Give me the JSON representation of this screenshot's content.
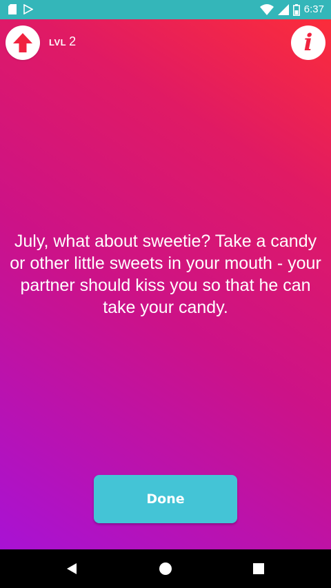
{
  "status_bar": {
    "time": "6:37",
    "icons": [
      "sd-card-icon",
      "play-store-icon",
      "wifi-icon",
      "signal-icon",
      "battery-icon"
    ]
  },
  "header": {
    "back_icon": "arrow-up-icon",
    "level_label": "LVL",
    "level_value": "2",
    "info_icon": "info-icon",
    "info_glyph": "i"
  },
  "content": {
    "message": "July, what about sweetie? Take a candy or other little sweets in your mouth - your partner should kiss you so that he can take your candy."
  },
  "actions": {
    "done_label": "Done"
  },
  "nav": {
    "icons": [
      "back-triangle-icon",
      "home-circle-icon",
      "recents-square-icon"
    ]
  },
  "colors": {
    "status_bar": "#34b6b9",
    "gradient_start": "#a812d4",
    "gradient_end": "#fb2d3a",
    "accent_red": "#f0233f",
    "done_button": "#44c4d6"
  }
}
